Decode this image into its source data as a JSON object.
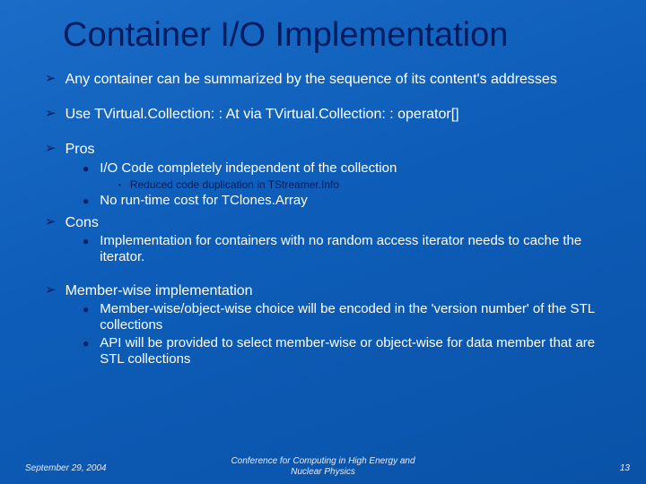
{
  "title": "Container I/O Implementation",
  "bullets": {
    "p1": "Any container can be summarized by the sequence of its content's addresses",
    "p2": "Use TVirtual.Collection: : At via TVirtual.Collection: : operator[]",
    "p3": "Pros",
    "p3a": "I/O Code completely independent of the collection",
    "p3a1": "Reduced code duplication in TStreamer.Info",
    "p3b": "No run-time cost for TClones.Array",
    "p4": "Cons",
    "p4a": "Implementation for containers with no random access iterator needs to cache the iterator.",
    "p5": "Member-wise implementation",
    "p5a": "Member-wise/object-wise choice will be encoded in the 'version number' of the STL collections",
    "p5b": "API will be provided to select member-wise or object-wise for data member that are STL collections"
  },
  "footer": {
    "date": "September 29, 2004",
    "conf_line1": "Conference for Computing in High Energy and",
    "conf_line2": "Nuclear Physics",
    "page": "13"
  }
}
